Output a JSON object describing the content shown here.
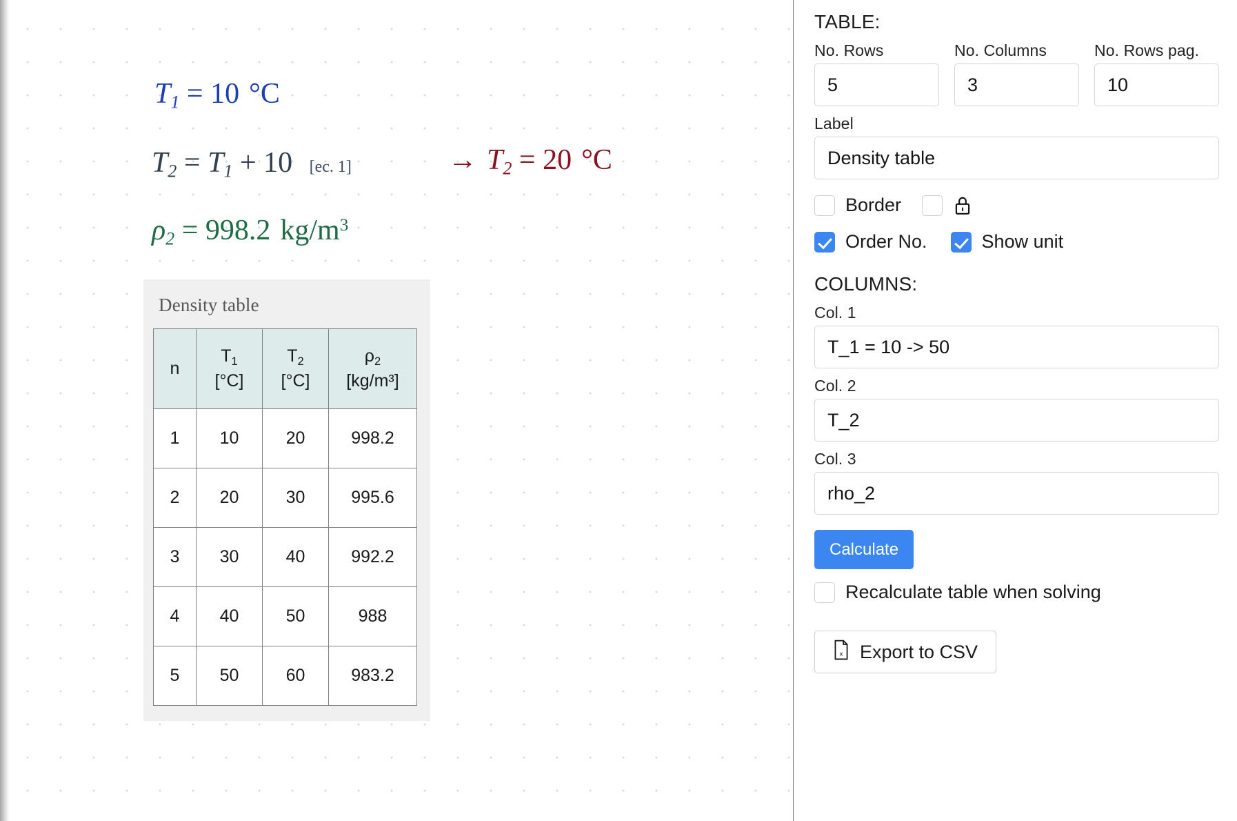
{
  "canvas": {
    "equations": [
      {
        "id": "eq1",
        "lhs_var": "T",
        "lhs_sub": "1",
        "eq": "=",
        "value": "10",
        "unit": "°C",
        "color": "#1d3faf"
      },
      {
        "id": "eq2",
        "text": "T_2 = T_1 + 10",
        "ref_tag": "[ec. 1]",
        "color": "#33404f"
      },
      {
        "id": "eq2result",
        "text": "→ T_2 = 20 °C",
        "arrow": "→",
        "value": "20",
        "unit": "°C",
        "color": "#8a1020"
      },
      {
        "id": "eq3",
        "text": "ρ_2 = 998.2 kg/m³",
        "value": "998.2",
        "unit": "kg/m³",
        "color": "#1f6b44"
      }
    ],
    "table_card": {
      "title": "Density table",
      "headers": [
        {
          "symbol": "n",
          "sub": "",
          "unit": ""
        },
        {
          "symbol": "T",
          "sub": "1",
          "unit": "[°C]"
        },
        {
          "symbol": "T",
          "sub": "2",
          "unit": "[°C]"
        },
        {
          "symbol": "ρ",
          "sub": "2",
          "unit": "[kg/m³]"
        }
      ],
      "rows": [
        [
          "1",
          "10",
          "20",
          "998.2"
        ],
        [
          "2",
          "20",
          "30",
          "995.6"
        ],
        [
          "3",
          "30",
          "40",
          "992.2"
        ],
        [
          "4",
          "40",
          "50",
          "988"
        ],
        [
          "5",
          "50",
          "60",
          "983.2"
        ]
      ]
    }
  },
  "panel": {
    "table_section_title": "TABLE:",
    "dims": {
      "rows": {
        "label": "No. Rows",
        "value": "5"
      },
      "columns": {
        "label": "No. Columns",
        "value": "3"
      },
      "rows_pag": {
        "label": "No. Rows pag.",
        "value": "10"
      }
    },
    "label_field": {
      "label": "Label",
      "value": "Density table"
    },
    "options": {
      "border": {
        "label": "Border",
        "checked": false
      },
      "lock": {
        "label": "",
        "checked": false,
        "icon": "lock-icon"
      },
      "order_no": {
        "label": "Order No.",
        "checked": true
      },
      "show_unit": {
        "label": "Show unit",
        "checked": true
      }
    },
    "columns_section_title": "COLUMNS:",
    "columns": [
      {
        "label": "Col. 1",
        "value": "T_1 = 10 -> 50"
      },
      {
        "label": "Col. 2",
        "value": "T_2"
      },
      {
        "label": "Col. 3",
        "value": "rho_2"
      }
    ],
    "calculate_button": "Calculate",
    "recalculate": {
      "label": "Recalculate table when solving",
      "checked": false
    },
    "export_button": "Export to CSV",
    "accent_color": "#3b86f0",
    "header_bg_color": "#ddeceb"
  }
}
